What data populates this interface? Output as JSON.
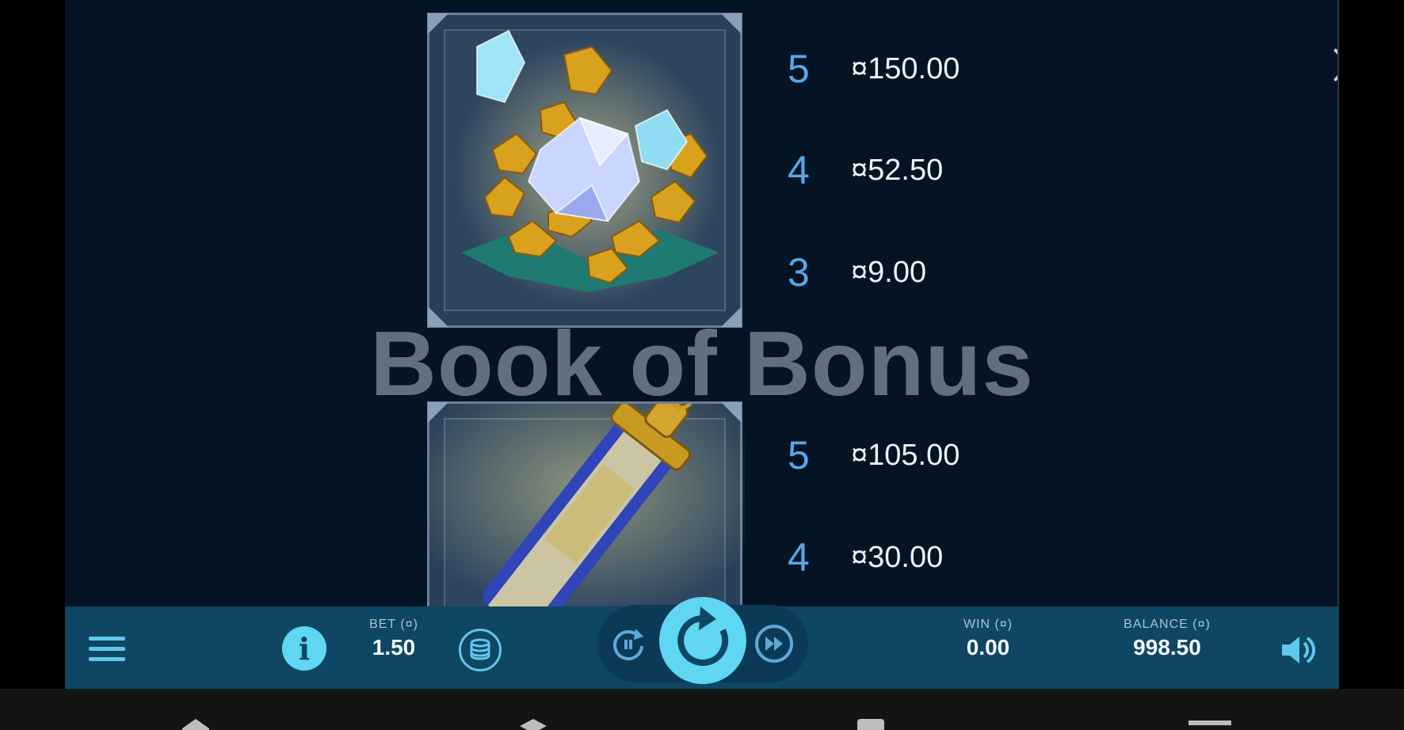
{
  "game_title": "Book of Bonus",
  "paytable": [
    {
      "symbol": "gold-crystals-symbol",
      "rows": [
        {
          "count": "5",
          "amount": "¤150.00"
        },
        {
          "count": "4",
          "amount": "¤52.50"
        },
        {
          "count": "3",
          "amount": "¤9.00"
        }
      ]
    },
    {
      "symbol": "scroll-symbol",
      "rows": [
        {
          "count": "5",
          "amount": "¤105.00"
        },
        {
          "count": "4",
          "amount": "¤30.00"
        }
      ]
    }
  ],
  "toolbar": {
    "bet_label": "BET (¤)",
    "bet_value": "1.50",
    "win_label": "WIN (¤)",
    "win_value": "0.00",
    "balance_label": "BALANCE (¤)",
    "balance_value": "998.50"
  },
  "icons": {
    "close": "close-icon",
    "menu": "menu-icon",
    "info": "info-icon",
    "coins": "coin-stack-icon",
    "autoplay": "autoplay-icon",
    "spin": "spin-icon",
    "turbo": "fast-forward-icon",
    "sound": "speaker-icon"
  },
  "colors": {
    "background": "#041424",
    "toolbar": "#0f4663",
    "accent": "#5fd6f2",
    "pay_count": "#5aa6e6"
  }
}
